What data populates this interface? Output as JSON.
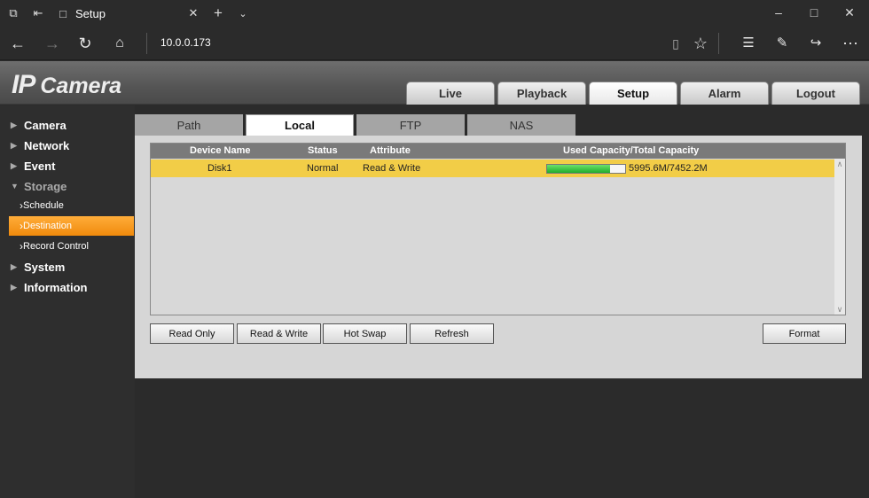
{
  "browser": {
    "tab_title": "Setup",
    "url": "10.0.0.173"
  },
  "app": {
    "logo_main": "IP",
    "logo_sub": "Camera"
  },
  "top_tabs": [
    {
      "label": "Live",
      "active": false
    },
    {
      "label": "Playback",
      "active": false
    },
    {
      "label": "Setup",
      "active": true
    },
    {
      "label": "Alarm",
      "active": false
    },
    {
      "label": "Logout",
      "active": false
    }
  ],
  "sidebar": {
    "items": [
      {
        "label": "Camera"
      },
      {
        "label": "Network"
      },
      {
        "label": "Event"
      },
      {
        "label": "Storage"
      },
      {
        "label": "System"
      },
      {
        "label": "Information"
      }
    ],
    "storage_sub": [
      {
        "label": "Schedule"
      },
      {
        "label": "Destination"
      },
      {
        "label": "Record Control"
      }
    ]
  },
  "sub_tabs": [
    {
      "label": "Path"
    },
    {
      "label": "Local"
    },
    {
      "label": "FTP"
    },
    {
      "label": "NAS"
    }
  ],
  "table": {
    "headers": {
      "device_name": "Device Name",
      "status": "Status",
      "attribute": "Attribute",
      "capacity": "Used Capacity/Total Capacity"
    },
    "rows": [
      {
        "device_name": "Disk1",
        "status": "Normal",
        "attribute": "Read & Write",
        "capacity_text": "5995.6M/7452.2M",
        "used_fraction": 0.805
      }
    ]
  },
  "buttons": {
    "read_only": "Read Only",
    "read_write": "Read & Write",
    "hot_swap": "Hot Swap",
    "refresh": "Refresh",
    "format": "Format"
  },
  "colors": {
    "selected_row": "#f2cd47",
    "active_sidebar": "#f59a1f",
    "capacity_fill": "#2fbf3a"
  }
}
